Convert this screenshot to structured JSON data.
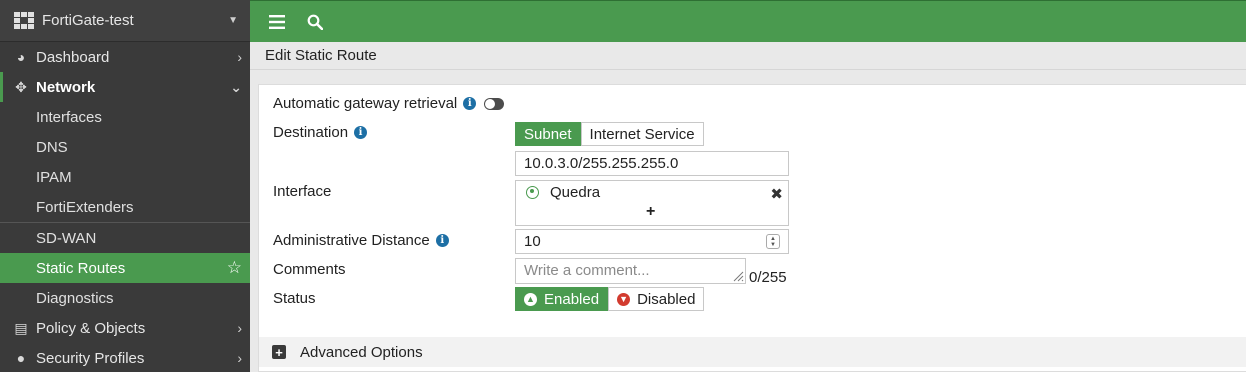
{
  "sidebar": {
    "device_name": "FortiGate-test",
    "items": [
      {
        "label": "Dashboard",
        "icon": "dashboard-icon"
      },
      {
        "label": "Network",
        "icon": "move-arrows-icon"
      },
      {
        "label": "Policy & Objects",
        "icon": "clipboard-icon"
      },
      {
        "label": "Security Profiles",
        "icon": "lock-icon"
      }
    ],
    "network_sub": [
      "Interfaces",
      "DNS",
      "IPAM",
      "FortiExtenders",
      "SD-WAN",
      "Static Routes",
      "Diagnostics"
    ]
  },
  "topbar": {
    "menu_icon": "hamburger-icon",
    "search_icon": "search-icon",
    "color": "#4a9a4f"
  },
  "page": {
    "title": "Edit Static Route"
  },
  "form": {
    "auto_gateway_label": "Automatic gateway retrieval",
    "auto_gateway_enabled": false,
    "destination_label": "Destination",
    "destination_options": [
      "Subnet",
      "Internet Service"
    ],
    "destination_selected": "Subnet",
    "destination_value": "10.0.3.0/255.255.255.0",
    "interface_label": "Interface",
    "interface_value": "Quedra",
    "interface_add": "+",
    "admin_distance_label": "Administrative Distance",
    "admin_distance_value": "10",
    "comments_label": "Comments",
    "comments_placeholder": "Write a comment...",
    "comments_counter": "0/255",
    "status_label": "Status",
    "status_options": [
      "Enabled",
      "Disabled"
    ],
    "status_selected": "Enabled",
    "advanced_label": "Advanced Options"
  },
  "colors": {
    "accent": "#4a9a4f",
    "info": "#1d6fa5",
    "disabled_red": "#d23b2f"
  }
}
